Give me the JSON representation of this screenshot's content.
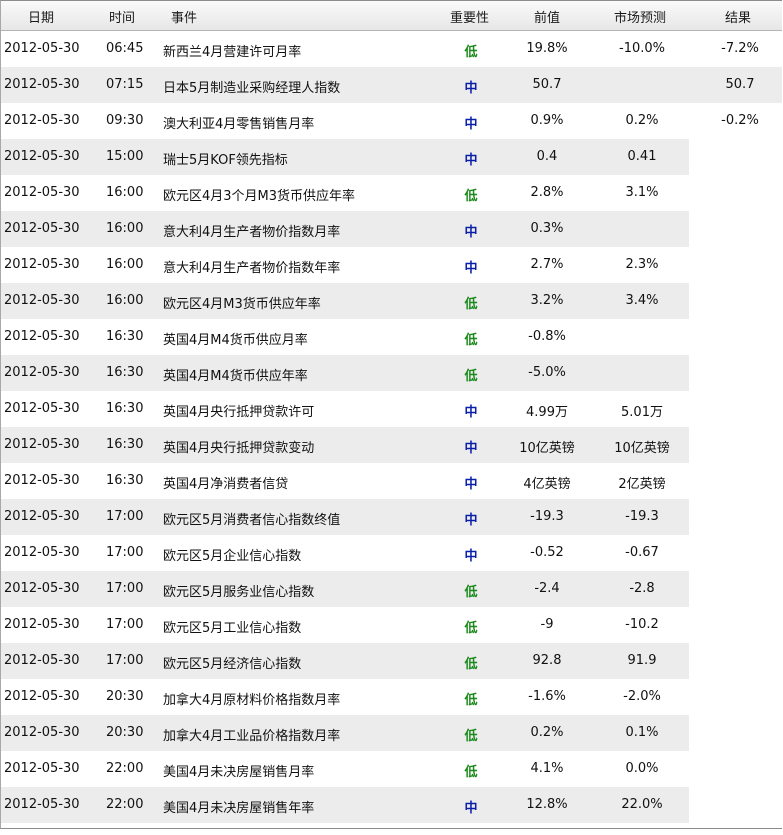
{
  "table": {
    "headers": {
      "date": "日期",
      "time": "时间",
      "event": "事件",
      "importance": "重要性",
      "previous": "前值",
      "forecast": "市场预测",
      "result": "结果"
    },
    "importance_colors": {
      "低": "#1a8a1a",
      "中": "#0a1fa8"
    },
    "rows": [
      {
        "date": "2012-05-30",
        "time": "06:45",
        "event": "新西兰4月营建许可月率",
        "importance": "低",
        "previous": "19.8%",
        "forecast": "-10.0%",
        "result": "-7.2%"
      },
      {
        "date": "2012-05-30",
        "time": "07:15",
        "event": "日本5月制造业采购经理人指数",
        "importance": "中",
        "previous": "50.7",
        "forecast": "",
        "result": "50.7"
      },
      {
        "date": "2012-05-30",
        "time": "09:30",
        "event": "澳大利亚4月零售销售月率",
        "importance": "中",
        "previous": "0.9%",
        "forecast": "0.2%",
        "result": "-0.2%"
      },
      {
        "date": "2012-05-30",
        "time": "15:00",
        "event": "瑞士5月KOF领先指标",
        "importance": "中",
        "previous": "0.4",
        "forecast": "0.41",
        "result": ""
      },
      {
        "date": "2012-05-30",
        "time": "16:00",
        "event": "欧元区4月3个月M3货币供应年率",
        "importance": "低",
        "previous": "2.8%",
        "forecast": "3.1%",
        "result": ""
      },
      {
        "date": "2012-05-30",
        "time": "16:00",
        "event": "意大利4月生产者物价指数月率",
        "importance": "中",
        "previous": "0.3%",
        "forecast": "",
        "result": ""
      },
      {
        "date": "2012-05-30",
        "time": "16:00",
        "event": "意大利4月生产者物价指数年率",
        "importance": "中",
        "previous": "2.7%",
        "forecast": "2.3%",
        "result": ""
      },
      {
        "date": "2012-05-30",
        "time": "16:00",
        "event": "欧元区4月M3货币供应年率",
        "importance": "低",
        "previous": "3.2%",
        "forecast": "3.4%",
        "result": ""
      },
      {
        "date": "2012-05-30",
        "time": "16:30",
        "event": "英国4月M4货币供应月率",
        "importance": "低",
        "previous": "-0.8%",
        "forecast": "",
        "result": ""
      },
      {
        "date": "2012-05-30",
        "time": "16:30",
        "event": "英国4月M4货币供应年率",
        "importance": "低",
        "previous": "-5.0%",
        "forecast": "",
        "result": ""
      },
      {
        "date": "2012-05-30",
        "time": "16:30",
        "event": "英国4月央行抵押贷款许可",
        "importance": "中",
        "previous": "4.99万",
        "forecast": "5.01万",
        "result": ""
      },
      {
        "date": "2012-05-30",
        "time": "16:30",
        "event": "英国4月央行抵押贷款变动",
        "importance": "中",
        "previous": "10亿英镑",
        "forecast": "10亿英镑",
        "result": ""
      },
      {
        "date": "2012-05-30",
        "time": "16:30",
        "event": "英国4月净消费者信贷",
        "importance": "中",
        "previous": "4亿英镑",
        "forecast": "2亿英镑",
        "result": ""
      },
      {
        "date": "2012-05-30",
        "time": "17:00",
        "event": "欧元区5月消费者信心指数终值",
        "importance": "中",
        "previous": "-19.3",
        "forecast": "-19.3",
        "result": ""
      },
      {
        "date": "2012-05-30",
        "time": "17:00",
        "event": "欧元区5月企业信心指数",
        "importance": "中",
        "previous": "-0.52",
        "forecast": "-0.67",
        "result": ""
      },
      {
        "date": "2012-05-30",
        "time": "17:00",
        "event": "欧元区5月服务业信心指数",
        "importance": "低",
        "previous": "-2.4",
        "forecast": "-2.8",
        "result": ""
      },
      {
        "date": "2012-05-30",
        "time": "17:00",
        "event": "欧元区5月工业信心指数",
        "importance": "低",
        "previous": "-9",
        "forecast": "-10.2",
        "result": ""
      },
      {
        "date": "2012-05-30",
        "time": "17:00",
        "event": "欧元区5月经济信心指数",
        "importance": "低",
        "previous": "92.8",
        "forecast": "91.9",
        "result": ""
      },
      {
        "date": "2012-05-30",
        "time": "20:30",
        "event": "加拿大4月原材料价格指数月率",
        "importance": "低",
        "previous": "-1.6%",
        "forecast": "-2.0%",
        "result": ""
      },
      {
        "date": "2012-05-30",
        "time": "20:30",
        "event": "加拿大4月工业品价格指数月率",
        "importance": "低",
        "previous": "0.2%",
        "forecast": "0.1%",
        "result": ""
      },
      {
        "date": "2012-05-30",
        "time": "22:00",
        "event": "美国4月未决房屋销售月率",
        "importance": "低",
        "previous": "4.1%",
        "forecast": "0.0%",
        "result": ""
      },
      {
        "date": "2012-05-30",
        "time": "22:00",
        "event": "美国4月未决房屋销售年率",
        "importance": "中",
        "previous": "12.8%",
        "forecast": "22.0%",
        "result": ""
      }
    ]
  }
}
